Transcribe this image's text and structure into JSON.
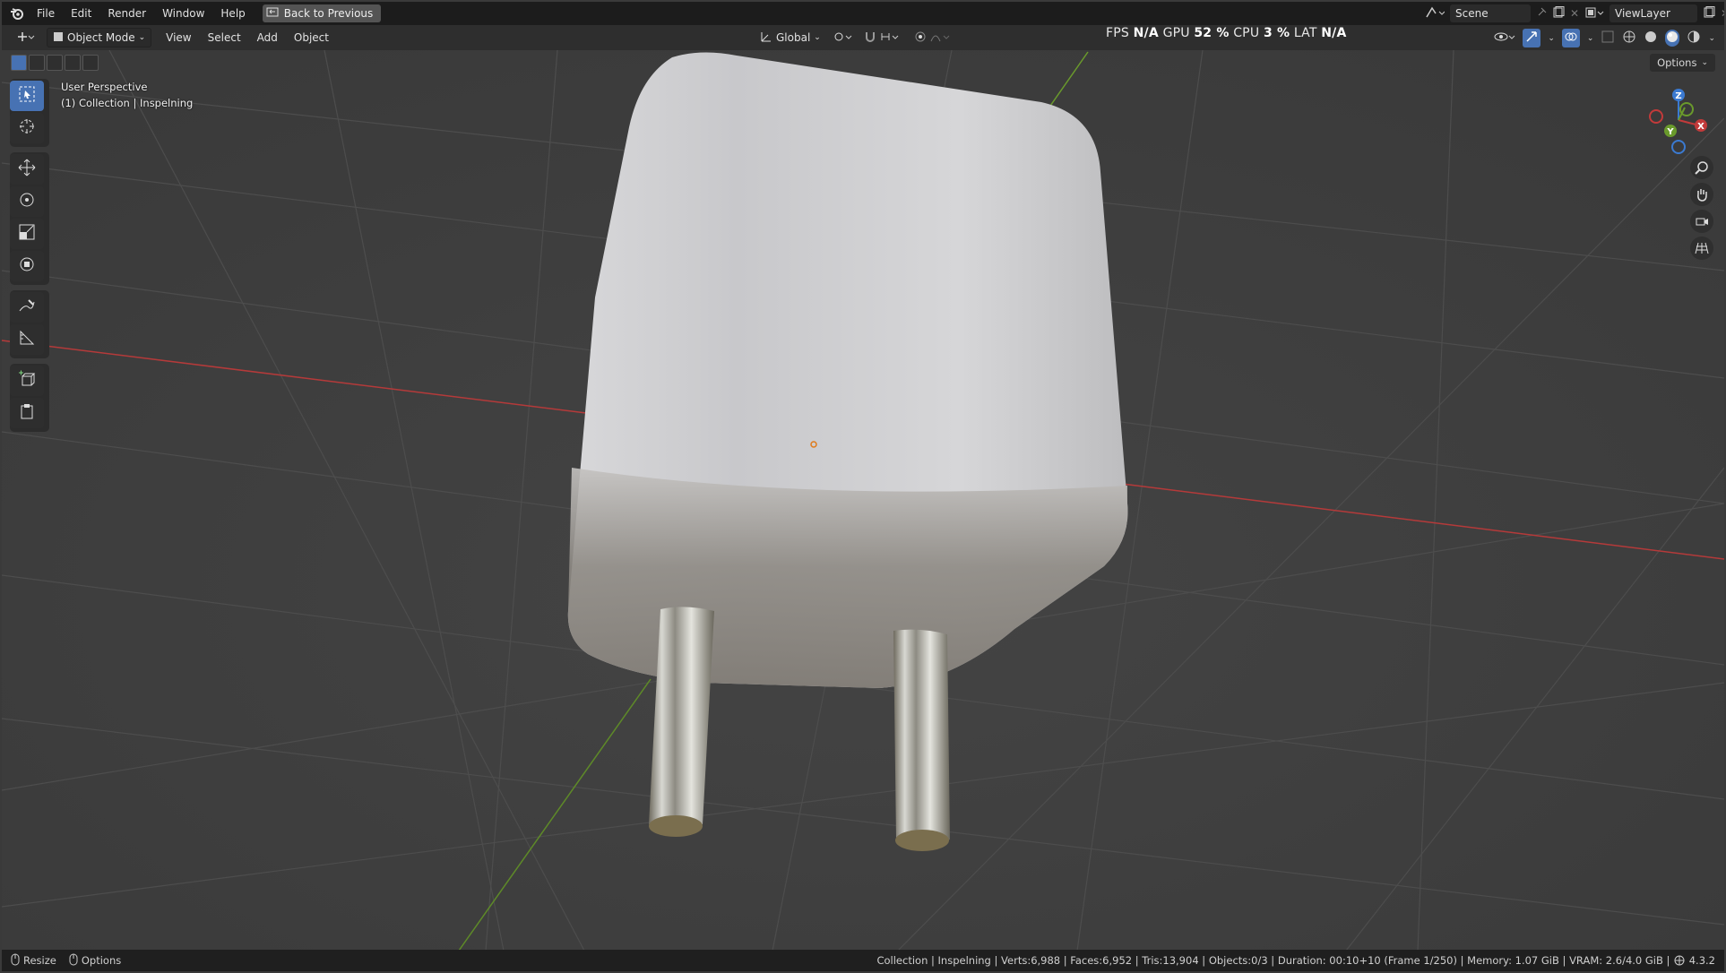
{
  "menu": {
    "items": [
      "File",
      "Edit",
      "Render",
      "Window",
      "Help"
    ],
    "back_button": "Back to Previous",
    "scene": "Scene",
    "view_layer": "ViewLayer"
  },
  "header": {
    "mode": "Object Mode",
    "menus": [
      "View",
      "Select",
      "Add",
      "Object"
    ],
    "orientation": "Global",
    "options": "Options"
  },
  "perf": {
    "fps_label": "FPS",
    "fps_value": "N/A",
    "gpu_label": "GPU",
    "gpu_value": "52 %",
    "cpu_label": "CPU",
    "cpu_value": "3 %",
    "lat_label": "LAT",
    "lat_value": "N/A"
  },
  "viewport": {
    "perspective": "User Perspective",
    "collection": "(1) Collection | Inspelning"
  },
  "status": {
    "resize": "Resize",
    "options": "Options",
    "info": "Collection | Inspelning | Verts:6,988 | Faces:6,952 | Tris:13,904 | Objects:0/3 | Duration: 00:10+10 (Frame 1/250) | Memory: 1.07 GiB | VRAM: 2.6/4.0 GiB |",
    "version": "4.3.2"
  },
  "colors": {
    "accent": "#4772b3",
    "axis_x": "#c23a3a",
    "axis_y": "#6a9a2c",
    "axis_z": "#3b7ad1"
  }
}
